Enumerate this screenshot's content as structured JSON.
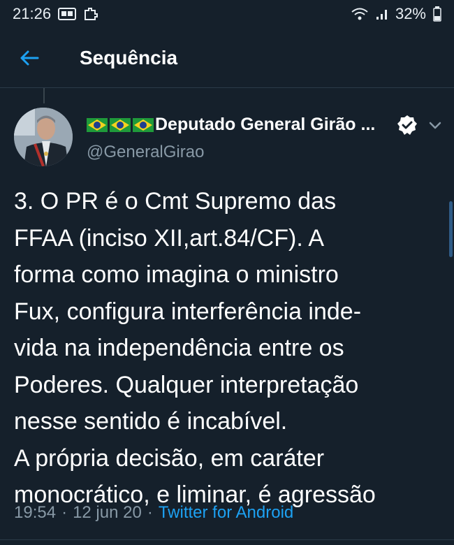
{
  "status_bar": {
    "time": "21:26",
    "battery": "32%",
    "icons": [
      "gallery-icon",
      "puzzle-icon",
      "wifi-icon",
      "signal-icon",
      "battery-icon"
    ]
  },
  "header": {
    "title": "Sequência",
    "back_icon": "arrow-left-icon"
  },
  "tweet": {
    "display_name": "Deputado General Girão ...",
    "flags_emoji": "🇧🇷🇧🇷🇧🇷",
    "handle": "@GeneralGirao",
    "verified": true,
    "text": "3. O PR é o Cmt Supremo das\nFFAA (inciso XII,art.84/CF). A\nforma como imagina o ministro\nFux, configura interferência inde-\nvida na independência entre os\nPoderes. Qualquer interpretação\nnesse sentido é incabível.\nA própria decisão, em caráter\nmonocrático, e liminar, é agressão",
    "time": "19:54",
    "separator": "·",
    "date": "12 jun 20",
    "source": "Twitter for Android"
  },
  "colors": {
    "background": "#15202b",
    "accent": "#1da1f2",
    "secondary_text": "#8899a6"
  }
}
